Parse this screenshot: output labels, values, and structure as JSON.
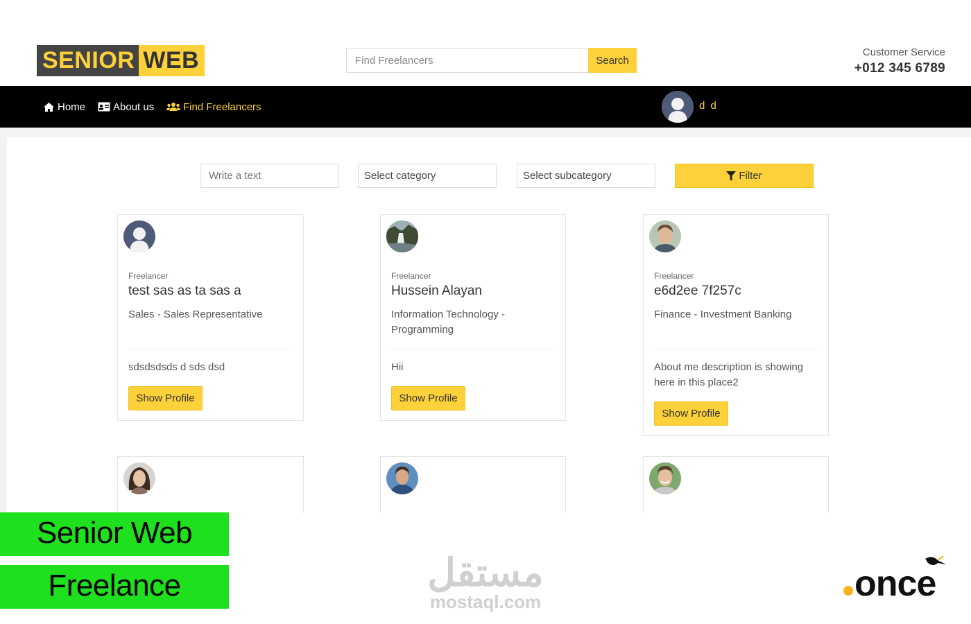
{
  "brand": {
    "part1": "SENIOR",
    "part2": "WEB"
  },
  "search": {
    "placeholder": "Find Freelancers",
    "button": "Search"
  },
  "customer_service": {
    "label": "Customer Service",
    "phone": "+012 345 6789"
  },
  "nav": {
    "items": [
      {
        "label": "Home",
        "icon": "home-icon"
      },
      {
        "label": "About us",
        "icon": "id-card-icon"
      },
      {
        "label": "Find Freelancers",
        "icon": "users-icon"
      }
    ],
    "user_name": "d d"
  },
  "filters": {
    "text_placeholder": "Write a text",
    "category": "Select category",
    "subcategory": "Select subcategory",
    "filter_button": "Filter"
  },
  "freelancers": [
    {
      "role": "Freelancer",
      "name": "test sas as ta sas a",
      "category": "Sales - Sales Representative",
      "description": "sdsdsdsds d sds dsd",
      "button": "Show Profile"
    },
    {
      "role": "Freelancer",
      "name": "Hussein Alayan",
      "category": "Information Technology - Programming",
      "description": "Hii",
      "button": "Show Profile"
    },
    {
      "role": "Freelancer",
      "name": "e6d2ee 7f257c",
      "category": "Finance - Investment Banking",
      "description": "About me description is showing here in this place2",
      "button": "Show Profile"
    }
  ],
  "overlay": {
    "banner1": "Senior Web",
    "banner2": "Freelance",
    "mostaql_ar": "مستقل",
    "mostaql_en": "mostaql.com",
    "once_logo": "once"
  },
  "colors": {
    "accent": "#fcd13a",
    "nav_bg": "#000000",
    "banner_green": "#1ee01e"
  }
}
